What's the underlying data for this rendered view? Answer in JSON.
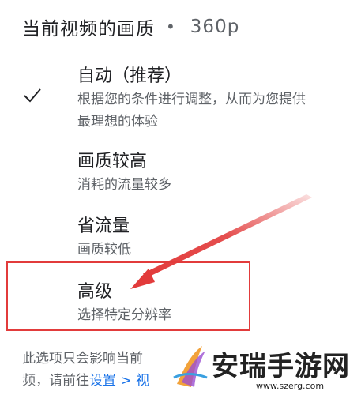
{
  "header": {
    "label": "当前视频的画质",
    "separator": "•",
    "current_quality": "360p"
  },
  "options": [
    {
      "title": "自动（推荐）",
      "desc_line1": "根据您的条件进行调整，从而为您提供",
      "desc_line2": "最理想的体验",
      "selected": true
    },
    {
      "title": "画质较高",
      "desc_line1": "消耗的流量较多",
      "selected": false
    },
    {
      "title": "省流量",
      "desc_line1": "画质较低",
      "selected": false
    },
    {
      "title": "高级",
      "desc_line1": "选择特定分辨率",
      "selected": false
    }
  ],
  "footer": {
    "line1": "此选项只会影响当前",
    "line2_prefix": "频，请前往",
    "link": "设置 > 视"
  },
  "watermark": {
    "brand": "安瑞手游网",
    "url": "www.szerg.com"
  },
  "colors": {
    "highlight": "#e23b3b",
    "link": "#1a73e8"
  },
  "icons": {
    "check": "check-icon",
    "arrow": "red-arrow-annotation"
  }
}
